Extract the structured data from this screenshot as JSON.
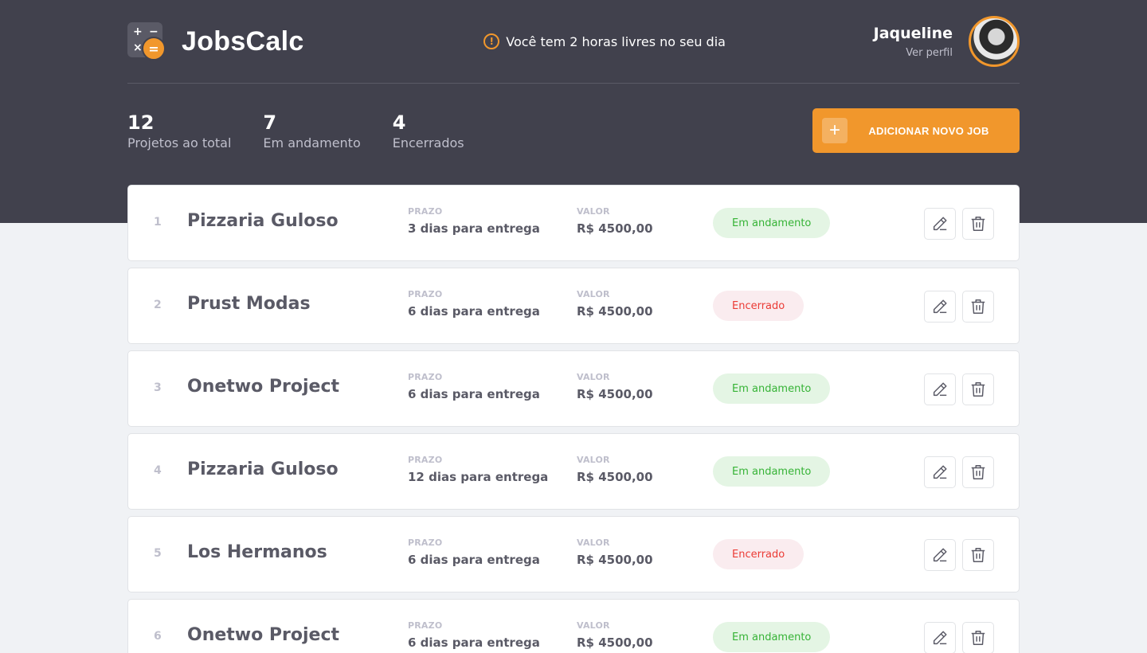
{
  "app": {
    "name": "JobsCalc",
    "logo_ops": [
      "+",
      "−",
      "×",
      "="
    ]
  },
  "notice": {
    "text": "Você tem 2 horas livres no seu dia",
    "icon": "alert-circle-icon"
  },
  "profile": {
    "name": "Jaqueline",
    "link": "Ver perfil"
  },
  "summary": [
    {
      "value": "12",
      "label": "Projetos ao total"
    },
    {
      "value": "7",
      "label": "Em andamento"
    },
    {
      "value": "4",
      "label": "Encerrados"
    }
  ],
  "add_button": {
    "icon": "+",
    "label": "ADICIONAR NOVO JOB"
  },
  "columns": {
    "deadline": "PRAZO",
    "value": "VALOR"
  },
  "jobs": [
    {
      "id": "1",
      "name": "Pizzaria Guloso",
      "deadline": "3 dias para entrega",
      "value": "R$ 4500,00",
      "status": "Em andamento",
      "status_type": "progress"
    },
    {
      "id": "2",
      "name": "Prust Modas",
      "deadline": "6 dias para entrega",
      "value": "R$ 4500,00",
      "status": "Encerrado",
      "status_type": "done"
    },
    {
      "id": "3",
      "name": "Onetwo Project",
      "deadline": "6 dias para entrega",
      "value": "R$ 4500,00",
      "status": "Em andamento",
      "status_type": "progress"
    },
    {
      "id": "4",
      "name": "Pizzaria Guloso",
      "deadline": "12 dias para entrega",
      "value": "R$ 4500,00",
      "status": "Em andamento",
      "status_type": "progress"
    },
    {
      "id": "5",
      "name": "Los Hermanos",
      "deadline": "6 dias para entrega",
      "value": "R$ 4500,00",
      "status": "Encerrado",
      "status_type": "done"
    },
    {
      "id": "6",
      "name": "Onetwo Project",
      "deadline": "6 dias para entrega",
      "value": "R$ 4500,00",
      "status": "Em andamento",
      "status_type": "progress"
    }
  ],
  "colors": {
    "header_bg": "#41414D",
    "accent": "#F1972C",
    "progress_bg": "#E4F5E4",
    "progress_text": "#36B336",
    "done_bg": "#FAECEF",
    "done_text": "#EB3B35"
  }
}
